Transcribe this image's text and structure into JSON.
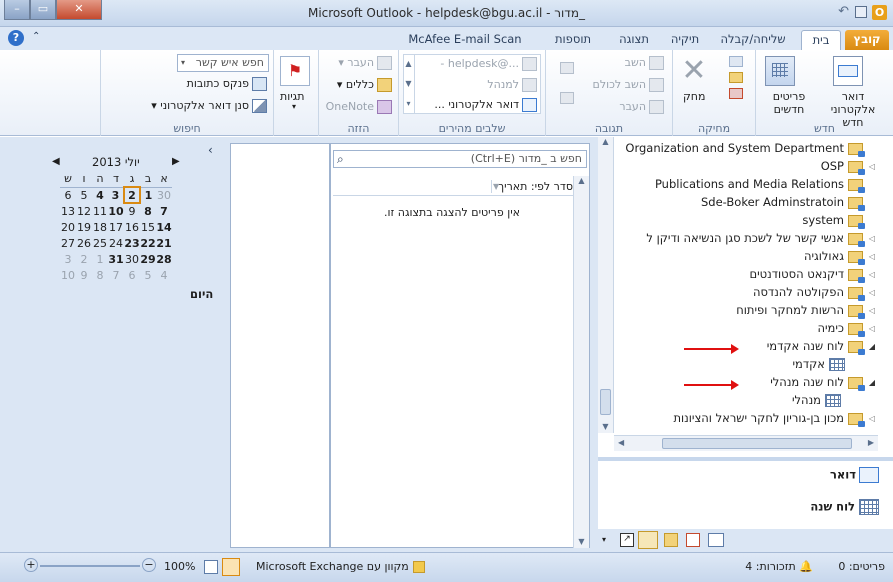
{
  "window": {
    "title": "Microsoft Outlook - helpdesk@bgu.ac.il - מדור_",
    "min": "–",
    "restore": "▭",
    "close": "✕"
  },
  "tabs": {
    "file": "קובץ",
    "home": "בית",
    "send_receive": "שליחה/קבלה",
    "folder": "תיקיה",
    "view": "תצוגה",
    "addins": "תוספות",
    "mcafee": "McAfee E-mail Scan"
  },
  "ribbon": {
    "new": {
      "label": "חדש",
      "new_email": "דואר\nאלקטרוני חדש",
      "new_items": "פריטים\nחדשים"
    },
    "delete": {
      "label": "מחיקה",
      "delete": "מחק"
    },
    "respond": {
      "label": "תגובה",
      "reply": "השב",
      "reply_all": "השב לכולם",
      "forward": "העבר"
    },
    "quick_steps": {
      "label": "שלבים מהירים",
      "step1": "...@helpdesk -",
      "step2": "למנהל",
      "step3": "דואר אלקטרוני ..."
    },
    "move": {
      "label": "הזזה",
      "move": "העבר",
      "rules": "כללים",
      "onenote": "OneNote"
    },
    "tags": {
      "label": "תגיות"
    },
    "find": {
      "label": "חיפוש",
      "find_contact_placeholder": "חפש איש קשר",
      "address_book": "פנקס כתובות",
      "filter_email": "סנן דואר אלקטרוני"
    }
  },
  "calendar": {
    "month": "יולי 2013",
    "days": [
      "א",
      "ב",
      "ג",
      "ד",
      "ה",
      "ו",
      "ש"
    ],
    "weeks": [
      [
        "30",
        "1",
        "2",
        "3",
        "4",
        "5",
        "6"
      ],
      [
        "7",
        "8",
        "9",
        "10",
        "11",
        "12",
        "13"
      ],
      [
        "14",
        "15",
        "16",
        "17",
        "18",
        "19",
        "20"
      ],
      [
        "21",
        "22",
        "23",
        "24",
        "25",
        "26",
        "27"
      ],
      [
        "28",
        "29",
        "30",
        "31",
        "1",
        "2",
        "3"
      ],
      [
        "4",
        "5",
        "6",
        "7",
        "8",
        "9",
        "10"
      ]
    ],
    "today": "היום"
  },
  "messages": {
    "search_placeholder": "חפש ב _מדור (Ctrl+E)",
    "sort_label": "סדר לפי: תאריך",
    "empty": "אין פריטים להצגה בתצוגה זו."
  },
  "nav": {
    "folders": [
      "Organization and System Department",
      "OSP",
      "Publications and Media Relations",
      "Sde-Boker Adminstratoin",
      "system",
      "אנשי קשר  של לשכת סגן הנשיאה ודיקן ל",
      "גאולוגיה",
      "דיקנאט הסטודנטים",
      "הפקולטה להנדסה",
      "הרשות למחקר ופיתוח",
      "כימיה",
      "לוח שנה אקדמי",
      "אקדמי",
      "לוח שנה מנהלי",
      "מנהלי",
      "מכון בן-גוריון לחקר ישראל והציונות"
    ],
    "mail": "דואר",
    "calendar": "לוח שנה"
  },
  "status": {
    "items": "פריטים: 0",
    "reminders": "תזכורות: 4",
    "connection": "מקוון עם Microsoft Exchange",
    "zoom": "100%"
  }
}
